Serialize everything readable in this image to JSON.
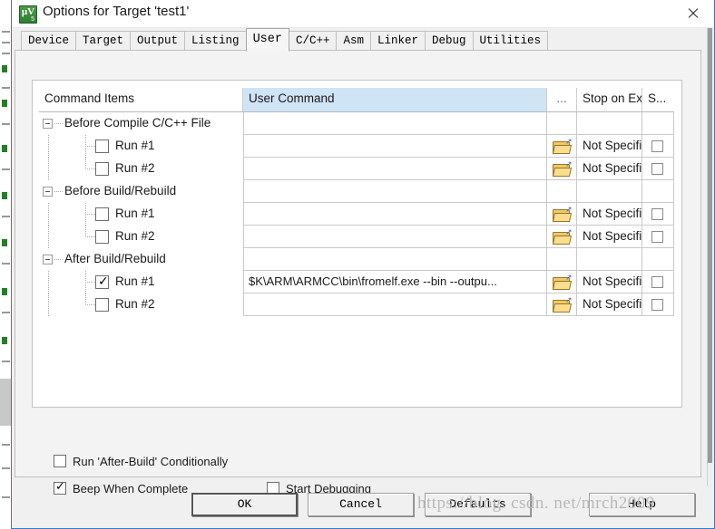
{
  "window": {
    "title": "Options for Target 'test1'",
    "app_icon": "keil-uvision5-icon",
    "icon_glyph": "μV",
    "icon_sub": "5",
    "close_label": "×"
  },
  "tabs": [
    {
      "label": "Device",
      "selected": false
    },
    {
      "label": "Target",
      "selected": false
    },
    {
      "label": "Output",
      "selected": false
    },
    {
      "label": "Listing",
      "selected": false
    },
    {
      "label": "User",
      "selected": true
    },
    {
      "label": "C/C++",
      "selected": false
    },
    {
      "label": "Asm",
      "selected": false
    },
    {
      "label": "Linker",
      "selected": false
    },
    {
      "label": "Debug",
      "selected": false
    },
    {
      "label": "Utilities",
      "selected": false
    }
  ],
  "grid": {
    "headers": {
      "command_items": "Command Items",
      "user_command": "User Command",
      "browse": "...",
      "stop_on_exit": "Stop on Exi...",
      "s_column": "S..."
    },
    "rows": [
      {
        "kind": "group",
        "label": "Before Compile C/C++ File",
        "expanded": true,
        "command": "",
        "stop_on_exit": "",
        "has_browse": false,
        "has_stop_checkbox": false
      },
      {
        "kind": "child",
        "label": "Run #1",
        "checked": false,
        "command": "",
        "stop_on_exit": "Not Specified",
        "has_browse": true,
        "has_stop_checkbox": true,
        "stop_checked": false
      },
      {
        "kind": "child",
        "label": "Run #2",
        "checked": false,
        "command": "",
        "stop_on_exit": "Not Specified",
        "has_browse": true,
        "has_stop_checkbox": true,
        "stop_checked": false
      },
      {
        "kind": "group",
        "label": "Before Build/Rebuild",
        "expanded": true,
        "command": "",
        "stop_on_exit": "",
        "has_browse": false,
        "has_stop_checkbox": false
      },
      {
        "kind": "child",
        "label": "Run #1",
        "checked": false,
        "command": "",
        "stop_on_exit": "Not Specified",
        "has_browse": true,
        "has_stop_checkbox": true,
        "stop_checked": false
      },
      {
        "kind": "child",
        "label": "Run #2",
        "checked": false,
        "command": "",
        "stop_on_exit": "Not Specified",
        "has_browse": true,
        "has_stop_checkbox": true,
        "stop_checked": false
      },
      {
        "kind": "group",
        "label": "After Build/Rebuild",
        "expanded": true,
        "command": "",
        "stop_on_exit": "",
        "has_browse": false,
        "has_stop_checkbox": false
      },
      {
        "kind": "child",
        "label": "Run #1",
        "checked": true,
        "command": "$K\\ARM\\ARMCC\\bin\\fromelf.exe --bin --outpu...",
        "stop_on_exit": "Not Specified",
        "has_browse": true,
        "has_stop_checkbox": true,
        "stop_checked": false
      },
      {
        "kind": "child",
        "label": "Run #2",
        "checked": false,
        "command": "",
        "stop_on_exit": "Not Specified",
        "has_browse": true,
        "has_stop_checkbox": true,
        "stop_checked": false
      }
    ]
  },
  "options": [
    {
      "label": "Run 'After-Build' Conditionally",
      "checked": false
    },
    {
      "label": "Beep When Complete",
      "checked": true
    },
    {
      "label": "Start Debugging",
      "checked": false
    }
  ],
  "buttons": [
    {
      "label": "OK",
      "default": true,
      "disabled": false
    },
    {
      "label": "Cancel",
      "default": false,
      "disabled": false
    },
    {
      "label": "Defaults",
      "default": false,
      "disabled": false
    },
    {
      "label": "Help",
      "default": false,
      "disabled": false
    }
  ],
  "watermark": "https://blog. csdn. net/mrch2009",
  "colors": {
    "accent": "#2b7fd0",
    "header_highlight": "#cfe4f5",
    "dialog_bg": "#f0f0f0",
    "grid_bg": "#ffffff",
    "folder_icon": "#f0c869"
  }
}
